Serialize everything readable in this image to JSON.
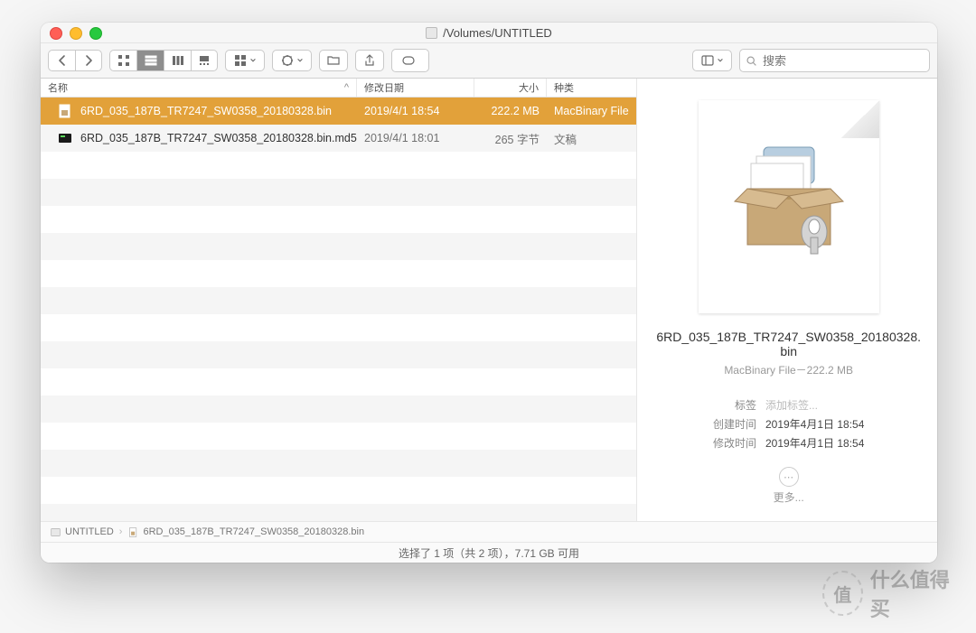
{
  "window": {
    "title": "/Volumes/UNTITLED"
  },
  "toolbar": {
    "search_placeholder": "搜索"
  },
  "columns": {
    "name": "名称",
    "date": "修改日期",
    "size": "大小",
    "kind": "种类"
  },
  "files": [
    {
      "name": "6RD_035_187B_TR7247_SW0358_20180328.bin",
      "date": "2019/4/1 18:54",
      "size": "222.2 MB",
      "kind": "MacBinary File",
      "selected": true,
      "icon": "archive"
    },
    {
      "name": "6RD_035_187B_TR7247_SW0358_20180328.bin.md5",
      "date": "2019/4/1 18:01",
      "size": "265 字节",
      "kind": "文稿",
      "selected": false,
      "icon": "exec"
    }
  ],
  "preview": {
    "name": "6RD_035_187B_TR7247_SW0358_20180328.bin",
    "meta": "MacBinary File－222.2 MB",
    "labels": {
      "tag_k": "标签",
      "tag_v": "添加标签...",
      "created_k": "创建时间",
      "created_v": "2019年4月1日 18:54",
      "modified_k": "修改时间",
      "modified_v": "2019年4月1日 18:54"
    },
    "more": "更多..."
  },
  "path": {
    "root": "UNTITLED",
    "leaf": "6RD_035_187B_TR7247_SW0358_20180328.bin"
  },
  "status": "选择了 1 项（共 2 项），7.71 GB 可用",
  "watermark": "什么值得买"
}
